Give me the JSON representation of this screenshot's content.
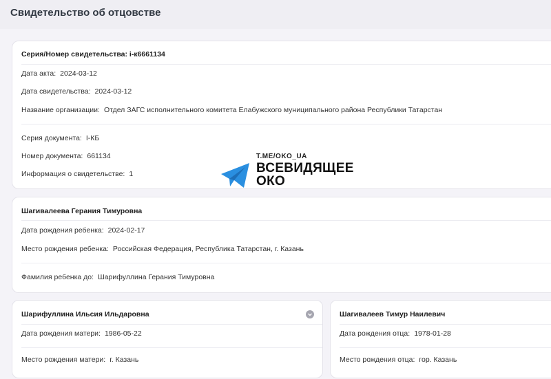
{
  "page": {
    "title": "Свидетельство об отцовстве"
  },
  "certificate": {
    "series_number_label": "Серия/Номер свидетельства:",
    "series_number_value": "i-к6661134",
    "act_date_label": "Дата акта:",
    "act_date_value": "2024-03-12",
    "cert_date_label": "Дата свидетельства:",
    "cert_date_value": "2024-03-12",
    "org_label": "Название организации:",
    "org_value": "Отдел ЗАГС исполнительного комитета Елабужского муниципального района Республики Татарстан",
    "doc_series_label": "Серия документа:",
    "doc_series_value": "I-КБ",
    "doc_number_label": "Номер документа:",
    "doc_number_value": "661134",
    "info_label": "Информация о свидетельстве:",
    "info_value": "1"
  },
  "child": {
    "name": "Шагивалеева Герания Тимуровна",
    "birth_date_label": "Дата рождения ребенка:",
    "birth_date_value": "2024-02-17",
    "birth_place_label": "Место рождения ребенка:",
    "birth_place_value": "Российская Федерация, Республика Татарстан, г. Казань",
    "prev_surname_label": "Фамилия ребенка до:",
    "prev_surname_value": "Шарифуллина Герания Тимуровна"
  },
  "mother": {
    "name": "Шарифуллина Ильсия Ильдаровна",
    "birth_date_label": "Дата рождения матери:",
    "birth_date_value": "1986-05-22",
    "birth_place_label": "Место рождения матери:",
    "birth_place_value": "г. Казань"
  },
  "father": {
    "name": "Шагивалеев Тимур Наилевич",
    "birth_date_label": "Дата рождения отца:",
    "birth_date_value": "1978-01-28",
    "birth_place_label": "Место рождения отца:",
    "birth_place_value": "гор. Казань"
  },
  "watermark": {
    "url": "T.ME/OKO_UA",
    "line1": "ВСЕВИДЯЩЕЕ",
    "line2": "ОКО",
    "icon": "telegram-icon",
    "color": "#2a8fe0"
  }
}
